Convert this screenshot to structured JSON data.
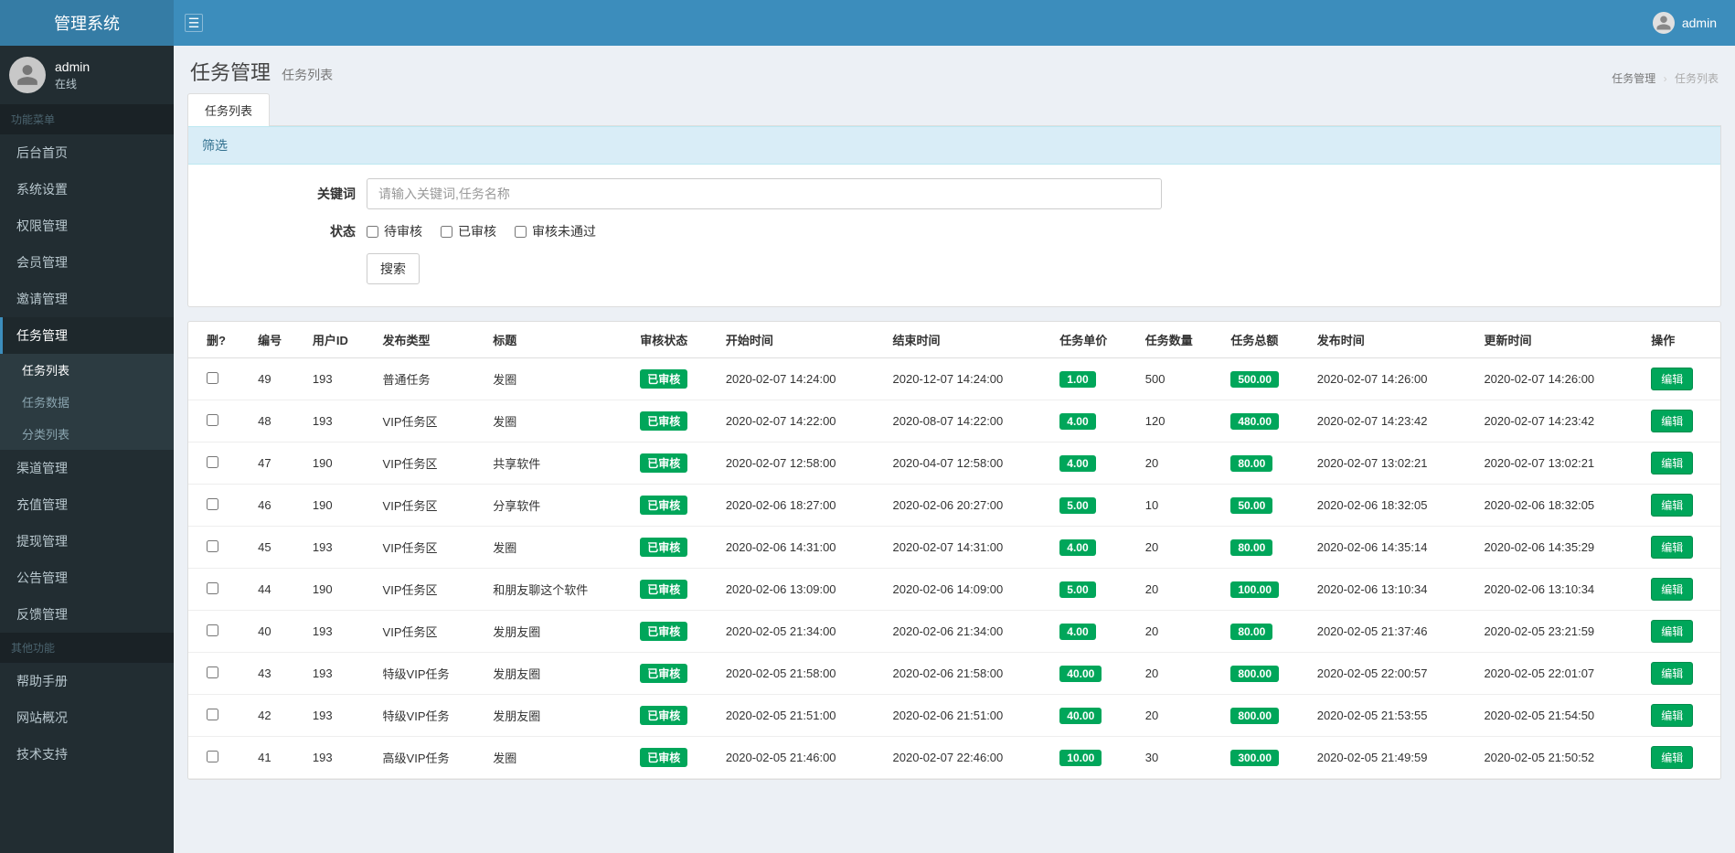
{
  "brand": "管理系统",
  "header": {
    "user_name": "admin"
  },
  "user_panel": {
    "name": "admin",
    "status": "在线"
  },
  "sidebar": {
    "section1": "功能菜单",
    "items": [
      "后台首页",
      "系统设置",
      "权限管理",
      "会员管理",
      "邀请管理",
      "任务管理"
    ],
    "sub_items": [
      "任务列表",
      "任务数据",
      "分类列表"
    ],
    "items2": [
      "渠道管理",
      "充值管理",
      "提现管理",
      "公告管理",
      "反馈管理"
    ],
    "section2": "其他功能",
    "items3": [
      "帮助手册",
      "网站概况",
      "技术支持"
    ]
  },
  "page": {
    "title": "任务管理",
    "subtitle": "任务列表",
    "breadcrumb": [
      "任务管理",
      "任务列表"
    ],
    "tab": "任务列表"
  },
  "filter": {
    "heading": "筛选",
    "keyword_label": "关键词",
    "keyword_placeholder": "请输入关键词,任务名称",
    "status_label": "状态",
    "status_options": [
      "待审核",
      "已审核",
      "审核未通过"
    ],
    "search_btn": "搜索"
  },
  "table": {
    "headers": [
      "删?",
      "编号",
      "用户ID",
      "发布类型",
      "标题",
      "审核状态",
      "开始时间",
      "结束时间",
      "任务单价",
      "任务数量",
      "任务总额",
      "发布时间",
      "更新时间",
      "操作"
    ],
    "edit_btn": "编辑",
    "status_approved": "已审核",
    "rows": [
      {
        "id": "49",
        "uid": "193",
        "type": "普通任务",
        "title": "发圈",
        "start": "2020-02-07 14:24:00",
        "end": "2020-12-07 14:24:00",
        "price": "1.00",
        "qty": "500",
        "total": "500.00",
        "pub": "2020-02-07 14:26:00",
        "upd": "2020-02-07 14:26:00"
      },
      {
        "id": "48",
        "uid": "193",
        "type": "VIP任务区",
        "title": "发圈",
        "start": "2020-02-07 14:22:00",
        "end": "2020-08-07 14:22:00",
        "price": "4.00",
        "qty": "120",
        "total": "480.00",
        "pub": "2020-02-07 14:23:42",
        "upd": "2020-02-07 14:23:42"
      },
      {
        "id": "47",
        "uid": "190",
        "type": "VIP任务区",
        "title": "共享软件",
        "start": "2020-02-07 12:58:00",
        "end": "2020-04-07 12:58:00",
        "price": "4.00",
        "qty": "20",
        "total": "80.00",
        "pub": "2020-02-07 13:02:21",
        "upd": "2020-02-07 13:02:21"
      },
      {
        "id": "46",
        "uid": "190",
        "type": "VIP任务区",
        "title": "分享软件",
        "start": "2020-02-06 18:27:00",
        "end": "2020-02-06 20:27:00",
        "price": "5.00",
        "qty": "10",
        "total": "50.00",
        "pub": "2020-02-06 18:32:05",
        "upd": "2020-02-06 18:32:05"
      },
      {
        "id": "45",
        "uid": "193",
        "type": "VIP任务区",
        "title": "发圈",
        "start": "2020-02-06 14:31:00",
        "end": "2020-02-07 14:31:00",
        "price": "4.00",
        "qty": "20",
        "total": "80.00",
        "pub": "2020-02-06 14:35:14",
        "upd": "2020-02-06 14:35:29"
      },
      {
        "id": "44",
        "uid": "190",
        "type": "VIP任务区",
        "title": "和朋友聊这个软件",
        "start": "2020-02-06 13:09:00",
        "end": "2020-02-06 14:09:00",
        "price": "5.00",
        "qty": "20",
        "total": "100.00",
        "pub": "2020-02-06 13:10:34",
        "upd": "2020-02-06 13:10:34"
      },
      {
        "id": "40",
        "uid": "193",
        "type": "VIP任务区",
        "title": "发朋友圈",
        "start": "2020-02-05 21:34:00",
        "end": "2020-02-06 21:34:00",
        "price": "4.00",
        "qty": "20",
        "total": "80.00",
        "pub": "2020-02-05 21:37:46",
        "upd": "2020-02-05 23:21:59"
      },
      {
        "id": "43",
        "uid": "193",
        "type": "特级VIP任务",
        "title": "发朋友圈",
        "start": "2020-02-05 21:58:00",
        "end": "2020-02-06 21:58:00",
        "price": "40.00",
        "qty": "20",
        "total": "800.00",
        "pub": "2020-02-05 22:00:57",
        "upd": "2020-02-05 22:01:07"
      },
      {
        "id": "42",
        "uid": "193",
        "type": "特级VIP任务",
        "title": "发朋友圈",
        "start": "2020-02-05 21:51:00",
        "end": "2020-02-06 21:51:00",
        "price": "40.00",
        "qty": "20",
        "total": "800.00",
        "pub": "2020-02-05 21:53:55",
        "upd": "2020-02-05 21:54:50"
      },
      {
        "id": "41",
        "uid": "193",
        "type": "高级VIP任务",
        "title": "发圈",
        "start": "2020-02-05 21:46:00",
        "end": "2020-02-07 22:46:00",
        "price": "10.00",
        "qty": "30",
        "total": "300.00",
        "pub": "2020-02-05 21:49:59",
        "upd": "2020-02-05 21:50:52"
      }
    ]
  }
}
